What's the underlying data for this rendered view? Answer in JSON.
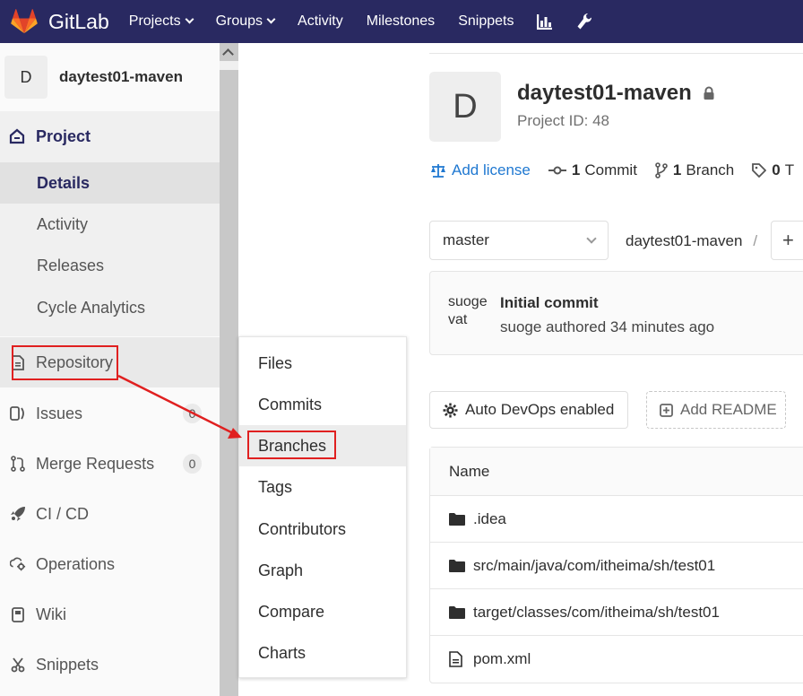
{
  "topnav": {
    "brand": "GitLab",
    "items": [
      "Projects",
      "Groups",
      "Activity",
      "Milestones",
      "Snippets"
    ]
  },
  "sidebar": {
    "avatar_letter": "D",
    "project_name": "daytest01-maven",
    "project_label": "Project",
    "sub_items": [
      "Details",
      "Activity",
      "Releases",
      "Cycle Analytics"
    ],
    "items": [
      {
        "label": "Repository"
      },
      {
        "label": "Issues",
        "badge": "0"
      },
      {
        "label": "Merge Requests",
        "badge": "0"
      },
      {
        "label": "CI / CD"
      },
      {
        "label": "Operations"
      },
      {
        "label": "Wiki"
      },
      {
        "label": "Snippets"
      }
    ]
  },
  "flyout": {
    "items": [
      "Files",
      "Commits",
      "Branches",
      "Tags",
      "Contributors",
      "Graph",
      "Compare",
      "Charts"
    ]
  },
  "project": {
    "avatar_letter": "D",
    "title": "daytest01-maven",
    "id_text": "Project ID: 48",
    "add_license": "Add license",
    "commits_count": "1",
    "commits_label": "Commit",
    "branches_count": "1",
    "branches_label": "Branch",
    "tags_count": "0",
    "tags_label": "T"
  },
  "repo": {
    "branch": "master",
    "path_root": "daytest01-maven",
    "path_sep": "/",
    "plus": "+"
  },
  "commit": {
    "avatar_text": "suoge vat",
    "title": "Initial commit",
    "meta": "suoge authored 34 minutes ago"
  },
  "buttons": {
    "devops": "Auto DevOps enabled",
    "readme": "Add README"
  },
  "files": {
    "header": "Name",
    "rows": [
      {
        "name": ".idea",
        "type": "folder"
      },
      {
        "name": "src/main/java/com/itheima/sh/test01",
        "type": "folder"
      },
      {
        "name": "target/classes/com/itheima/sh/test01",
        "type": "folder"
      },
      {
        "name": "pom.xml",
        "type": "file"
      }
    ]
  },
  "colors": {
    "nav_bg": "#292961",
    "link": "#1f78d1",
    "annotation": "#e02020"
  }
}
